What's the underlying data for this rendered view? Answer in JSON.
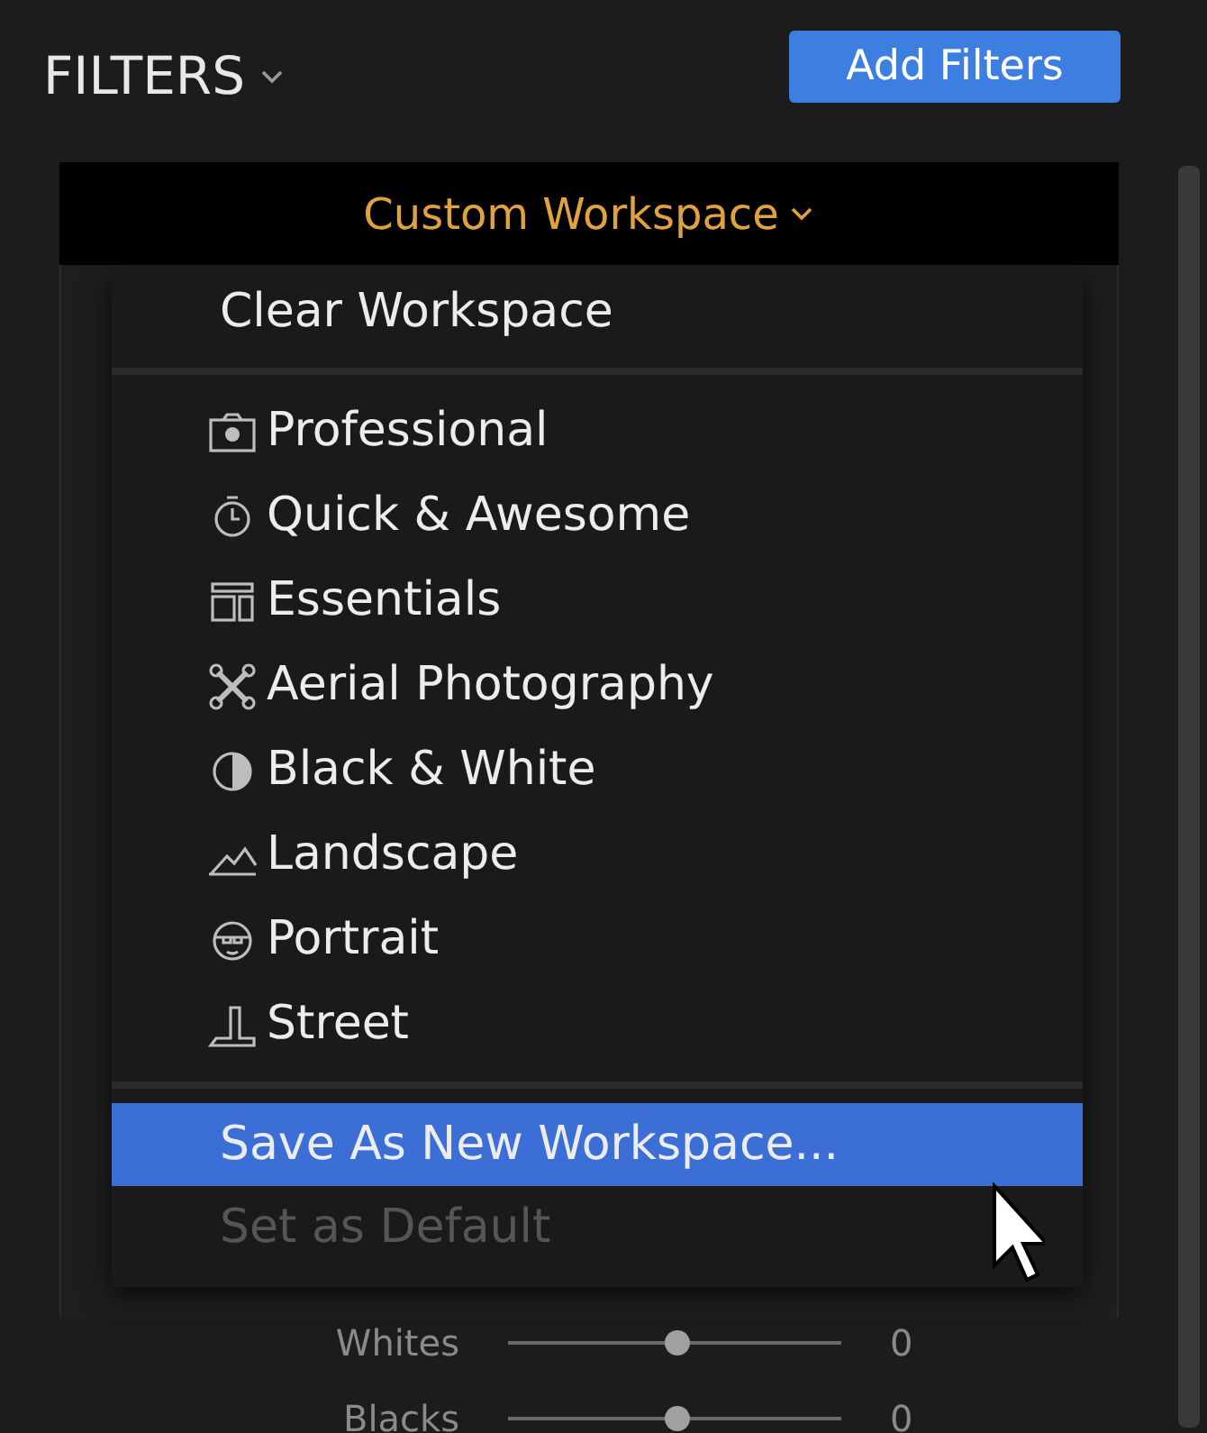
{
  "header": {
    "title": "FILTERS",
    "button": "Add Filters"
  },
  "workspace": {
    "label": "Custom Workspace"
  },
  "menu": {
    "items": [
      {
        "kind": "action",
        "label": "Clear Workspace",
        "highlighted": false,
        "disabled": false
      },
      {
        "kind": "separator"
      },
      {
        "kind": "preset",
        "label": "Professional"
      },
      {
        "kind": "preset",
        "label": "Quick & Awesome"
      },
      {
        "kind": "preset",
        "label": "Essentials"
      },
      {
        "kind": "preset",
        "label": "Aerial Photography"
      },
      {
        "kind": "preset",
        "label": "Black & White"
      },
      {
        "kind": "preset",
        "label": "Landscape"
      },
      {
        "kind": "preset",
        "label": "Portrait"
      },
      {
        "kind": "preset",
        "label": "Street"
      },
      {
        "kind": "separator"
      },
      {
        "kind": "action",
        "label": "Save As New Workspace...",
        "highlighted": true,
        "disabled": false
      },
      {
        "kind": "action",
        "label": "Set as Default",
        "highlighted": false,
        "disabled": true
      }
    ]
  },
  "sliders": [
    {
      "name": "Whites",
      "level": 0.51,
      "reading": "0"
    },
    {
      "name": "Blacks",
      "level": 0.51,
      "reading": "0"
    }
  ]
}
